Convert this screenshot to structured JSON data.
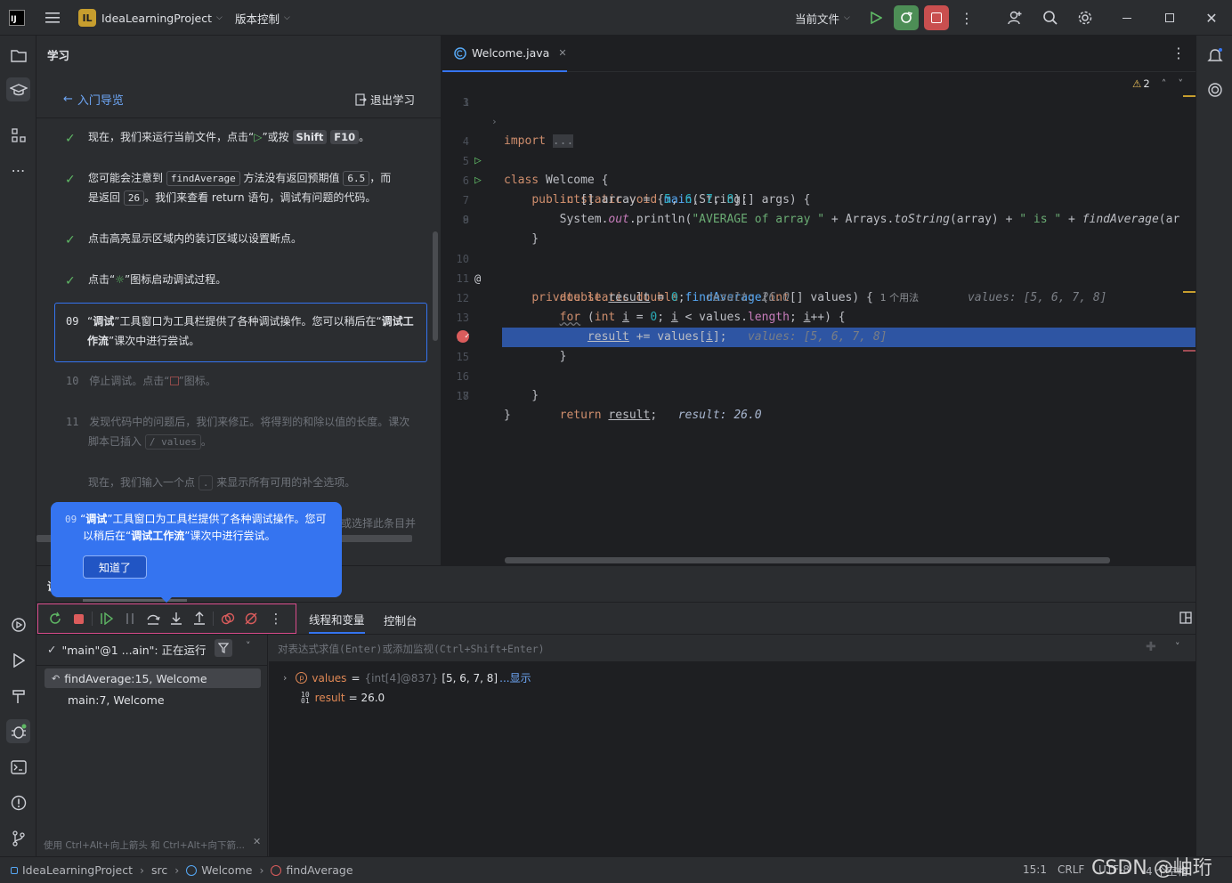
{
  "titlebar": {
    "project_badge": "IL",
    "project_name": "IdeaLearningProject",
    "vcs_label": "版本控制",
    "run_config": "当前文件"
  },
  "learn": {
    "panel_title": "学习",
    "back_label": "入门导览",
    "exit_label": "退出学习",
    "steps": [
      {
        "pre": "现在，我们来运行当前文件，点击“",
        "post": "”或按",
        "key1": "Shift",
        "key2": "F10",
        "end": "。"
      },
      {
        "l1a": "您可能会注意到",
        "chip1": "findAverage",
        "l1b": "方法没有返回预期值",
        "chip2": "6.5",
        "l1c": "，而",
        "l2a": "是返回",
        "chip3": "26",
        "l2b": "。我们来查看 return 语句，调试有问题的代码。"
      },
      {
        "text": "点击高亮显示区域内的装订区域以设置断点。"
      },
      {
        "pre": "点击“",
        "post": "”图标启动调试过程。"
      },
      {
        "num": "09",
        "a": "“",
        "b1": "调试",
        "c": "”工具窗口为工具栏提供了各种调试操作。您可以稍后在“",
        "b2": "调试工作流",
        "d": "”课次中进行尝试。"
      },
      {
        "num": "10",
        "pre": "停止调试。点击“",
        "post": "”图标。"
      },
      {
        "num": "11",
        "l1": "发现代码中的问题后，我们来修正。将得到的和除以值的长度。课次",
        "l2a": "脚本已插入",
        "chip": "/ values",
        "l2b": "。"
      },
      {
        "pre": "现在，我们输入一个点",
        "chip": ".",
        "post": "来显示所有可用的补全选项。"
      },
      {
        "tail": "或选择此条目并"
      }
    ]
  },
  "popup": {
    "num": "09",
    "a": "“",
    "b1": "调试",
    "c": "”工具窗口为工具栏提供了各种调试操作。您可",
    "d": "以稍后在“",
    "b2": "调试工作流",
    "e": "”课次中进行尝试。",
    "button": "知道了"
  },
  "editor": {
    "tab_name": "Welcome.java",
    "warnings": "2",
    "usages": "1 个用法",
    "lines": [
      "1",
      "3",
      "4",
      "5",
      "6",
      "7",
      "8",
      "9",
      "10",
      "11",
      "12",
      "13",
      "14",
      "15",
      "16",
      "17",
      "18"
    ]
  },
  "debug": {
    "panel_label": "调",
    "tab_threads": "线程和变量",
    "tab_console": "控制台",
    "thread": "\"main\"@1 ...ain\": 正在运行",
    "frames": [
      "findAverage:15, Welcome",
      "main:7, Welcome"
    ],
    "eval_placeholder": "对表达式求值(Enter)或添加监视(Ctrl+Shift+Enter)",
    "vars": {
      "values_name": "values",
      "eq": "=",
      "values_type": "{int[4]@837}",
      "values_val": "[5, 6, 7, 8]",
      "values_more": "...显示",
      "result_name": "result",
      "result_val": "= 26.0"
    },
    "hint": "使用 Ctrl+Alt+向上箭头 和 Ctrl+Alt+向下箭..."
  },
  "statusbar": {
    "crumbs": [
      "IdeaLearningProject",
      "src",
      "Welcome",
      "findAverage"
    ],
    "position": "15:1",
    "line_sep": "CRLF",
    "encoding": "UTF-8",
    "indent": "4 个空格",
    "watermark": "CSDN @岫珩"
  },
  "colors": {
    "accent": "#3574f0",
    "run_green": "#5fb865",
    "stop_red": "#db5c5c",
    "exec_line": "#2e55a3"
  }
}
